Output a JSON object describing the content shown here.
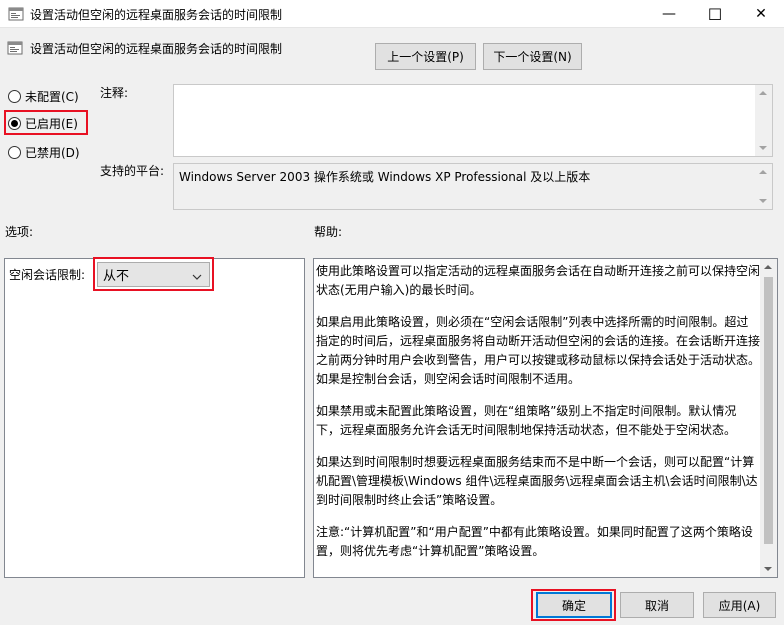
{
  "window": {
    "title": "设置活动但空闲的远程桌面服务会话的时间限制",
    "minimize_glyph": "—",
    "maximize_glyph": "☐",
    "close_glyph": "✕"
  },
  "header": {
    "policy_title": "设置活动但空闲的远程桌面服务会话的时间限制",
    "prev_button": "上一个设置(P)",
    "next_button": "下一个设置(N)"
  },
  "state": {
    "options": [
      {
        "label": "未配置(C)",
        "checked": false
      },
      {
        "label": "已启用(E)",
        "checked": true
      },
      {
        "label": "已禁用(D)",
        "checked": false
      }
    ]
  },
  "comment": {
    "label": "注释:",
    "value": ""
  },
  "platform": {
    "label": "支持的平台:",
    "value": "Windows Server 2003 操作系统或 Windows XP Professional 及以上版本"
  },
  "options_section": {
    "label": "选项:",
    "idle_label": "空闲会话限制:",
    "idle_value": "从不"
  },
  "help_section": {
    "label": "帮助:",
    "paragraphs": [
      "使用此策略设置可以指定活动的远程桌面服务会话在自动断开连接之前可以保持空闲状态(无用户输入)的最长时间。",
      "如果启用此策略设置，则必须在“空闲会话限制”列表中选择所需的时间限制。超过指定的时间后，远程桌面服务将自动断开活动但空闲的会话的连接。在会话断开连接之前两分钟时用户会收到警告，用户可以按键或移动鼠标以保持会话处于活动状态。如果是控制台会话，则空闲会话时间限制不适用。",
      "如果禁用或未配置此策略设置，则在“组策略”级别上不指定时间限制。默认情况下，远程桌面服务允许会话无时间限制地保持活动状态，但不能处于空闲状态。",
      "如果达到时间限制时想要远程桌面服务结束而不是中断一个会话，则可以配置“计算机配置\\管理模板\\Windows 组件\\远程桌面服务\\远程桌面会话主机\\会话时间限制\\达到时间限制时终止会话”策略设置。",
      "注意:“计算机配置”和“用户配置”中都有此策略设置。如果同时配置了这两个策略设置，则将优先考虑“计算机配置”策略设置。"
    ]
  },
  "footer": {
    "ok": "确定",
    "cancel": "取消",
    "apply": "应用(A)"
  },
  "colors": {
    "highlight_red": "#e81123",
    "accent_blue": "#0078d7"
  }
}
